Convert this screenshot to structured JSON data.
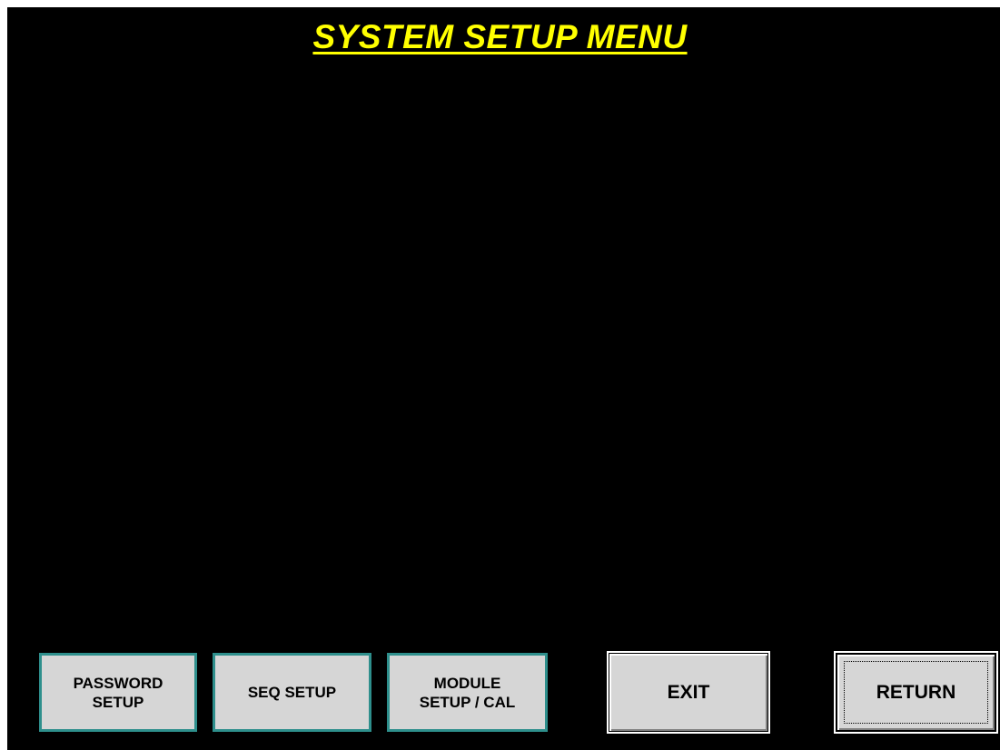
{
  "screen": {
    "title": "SYSTEM SETUP MENU",
    "title_color": "#ffff00",
    "background_color": "#000000"
  },
  "buttons": {
    "password_setup": "PASSWORD\nSETUP",
    "seq_setup": "SEQ SETUP",
    "module_setup": "MODULE\nSETUP / CAL",
    "exit": "EXIT",
    "return": "RETURN"
  },
  "colors": {
    "button_face": "#d6d6d6",
    "button_frame_accent": "#2e8f8c"
  }
}
